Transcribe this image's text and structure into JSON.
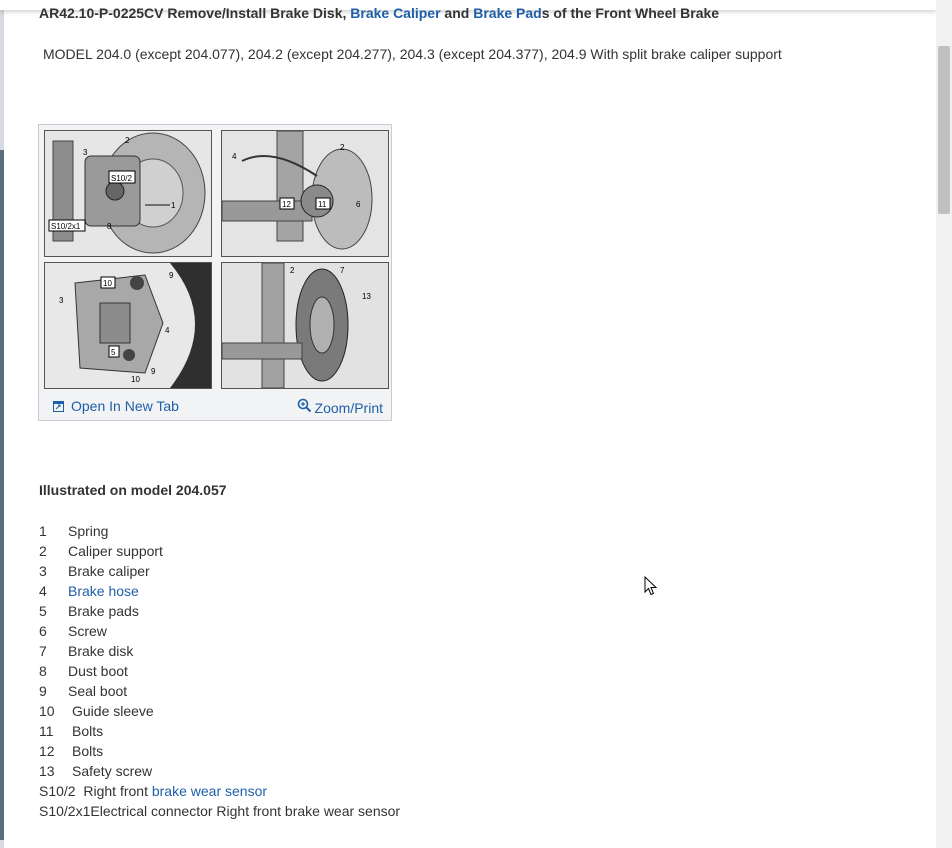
{
  "document": {
    "title_prefix": "AR42.10-P-0225CV Remove/Install Brake Disk, ",
    "title_link1": "Brake Caliper",
    "title_mid": " and ",
    "title_link2": "Brake Pad",
    "title_suffix": "s of the Front Wheel Brake",
    "model_line": "MODEL 204.0 (except 204.077), 204.2 (except 204.277), 204.3 (except 204.377), 204.9 With split brake caliper support"
  },
  "figure": {
    "open_tab_label": "Open In New Tab",
    "zoom_label": "Zoom/Print",
    "panel1_labels": [
      "2",
      "3",
      "S10/2",
      "1",
      "S10/2x1",
      "8"
    ],
    "panel2_labels": [
      "4",
      "2",
      "12",
      "11",
      "6"
    ],
    "panel3_labels": [
      "10",
      "9",
      "3",
      "4",
      "5",
      "10",
      "9"
    ],
    "panel4_labels": [
      "2",
      "7",
      "13"
    ]
  },
  "legend": {
    "heading": "Illustrated on model 204.057",
    "items": [
      {
        "num": "1",
        "label": "Spring"
      },
      {
        "num": "2",
        "label": "Caliper support"
      },
      {
        "num": "3",
        "label": "Brake caliper"
      },
      {
        "num": "4",
        "label": "Brake hose"
      },
      {
        "num": "5",
        "label": "Brake pads"
      },
      {
        "num": "6",
        "label": "Screw"
      },
      {
        "num": "7",
        "label": "Brake disk"
      },
      {
        "num": "8",
        "label": "Dust boot"
      },
      {
        "num": "9",
        "label": "Seal boot"
      },
      {
        "num": "10",
        "label": "Guide sleeve"
      },
      {
        "num": "11",
        "label": "Bolts"
      },
      {
        "num": "12",
        "label": "Bolts"
      },
      {
        "num": "13",
        "label": "Safety screw"
      }
    ],
    "s10_2_num": "S10/2",
    "s10_2_text": "Right front ",
    "s10_2_link": "brake wear sensor",
    "s10_2x1_num": "S10/2x1",
    "s10_2x1_text": "Electrical connector Right front brake wear sensor"
  },
  "colors": {
    "link": "#1f5fa8",
    "text": "#333333"
  }
}
